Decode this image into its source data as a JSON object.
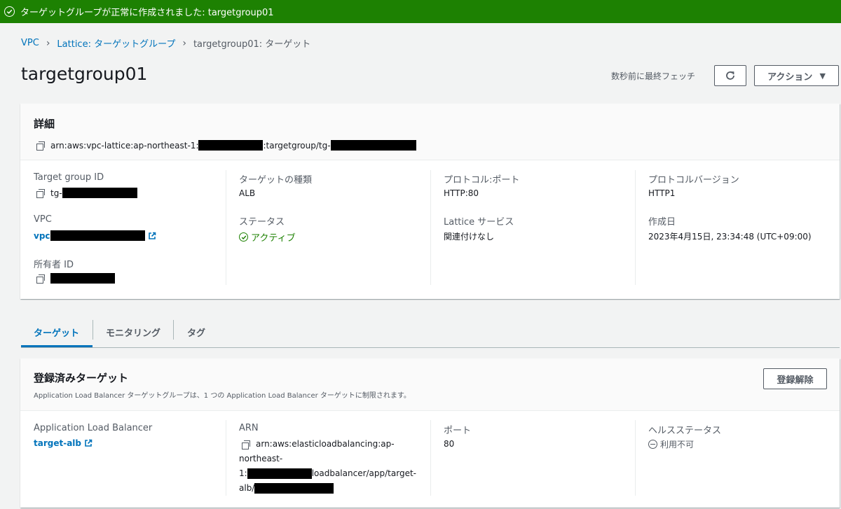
{
  "flash": {
    "message": "ターゲットグループが正常に作成されました: targetgroup01",
    "color": "#1d8102"
  },
  "breadcrumb": {
    "items": [
      "VPC",
      "Lattice: ターゲットグループ"
    ],
    "current": "targetgroup01: ターゲット"
  },
  "page": {
    "title": "targetgroup01",
    "fetch_text": "数秒前に最終フェッチ",
    "actions_label": "アクション",
    "refresh_icon": "refresh-icon"
  },
  "details": {
    "heading": "詳細",
    "arn_prefix": "arn:aws:vpc-lattice:ap-northeast-1:",
    "arn_mid": ":targetgroup/tg-",
    "fields": {
      "target_group_id": {
        "label": "Target group ID",
        "value": "tg-"
      },
      "vpc": {
        "label": "VPC",
        "value": "vpc"
      },
      "owner_id": {
        "label": "所有者 ID"
      },
      "target_type": {
        "label": "ターゲットの種類",
        "value": "ALB"
      },
      "status": {
        "label": "ステータス",
        "value": "アクティブ"
      },
      "protocol_port": {
        "label": "プロトコル:ポート",
        "value": "HTTP:80"
      },
      "lattice_service": {
        "label": "Lattice サービス",
        "value": "関連付けなし"
      },
      "protocol_version": {
        "label": "プロトコルバージョン",
        "value": "HTTP1"
      },
      "created": {
        "label": "作成日",
        "value": "2023年4月15日, 23:34:48 (UTC+09:00)"
      }
    }
  },
  "tabs": [
    {
      "label": "ターゲット",
      "active": true
    },
    {
      "label": "モニタリング",
      "active": false
    },
    {
      "label": "タグ",
      "active": false
    }
  ],
  "registered": {
    "heading": "登録済みターゲット",
    "description": "Application Load Balancer ターゲットグループは、1 つの Application Load Balancer ターゲットに制限されます。",
    "deregister_label": "登録解除",
    "columns": {
      "alb": {
        "label": "Application Load Balancer",
        "value": "target-alb"
      },
      "arn": {
        "label": "ARN",
        "line1": "arn:aws:elasticloadbalancing:ap-",
        "line2": "northeast-",
        "line3_prefix": "1:",
        "line3_suffix": "loadbalancer/app/target-",
        "line4_prefix": "alb/"
      },
      "port": {
        "label": "ポート",
        "value": "80"
      },
      "health": {
        "label": "ヘルスステータス",
        "value": "利用不可"
      }
    }
  },
  "colors": {
    "link": "#0073bb",
    "success": "#1d8102",
    "text_secondary": "#545b64"
  }
}
